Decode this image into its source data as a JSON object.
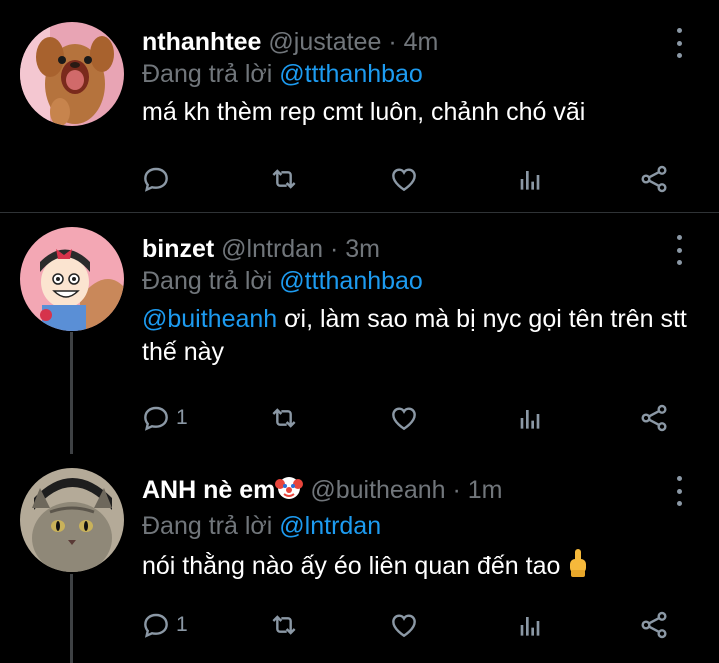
{
  "tweets": [
    {
      "display_name": "nthanhtee",
      "handle": "@justatee",
      "time": "· 4m",
      "replying_prefix": "Đang trả lời",
      "replying_to": "@ttthanhbao",
      "text": "má kh thèm rep cmt luôn, chảnh chó vãi",
      "reply_count": ""
    },
    {
      "display_name": "binzet",
      "handle": "@lntrdan",
      "time": "· 3m",
      "replying_prefix": "Đang trả lời",
      "replying_to": "@ttthanhbao",
      "text_mention": "@buitheanh",
      "text": " ơi, làm sao mà bị nyc gọi tên trên stt thế này",
      "reply_count": "1"
    },
    {
      "display_name": "ANH nè em",
      "display_name_emoji": "clown-face",
      "handle": "@buitheanh",
      "time": "· 1m",
      "replying_prefix": "Đang trả lời",
      "replying_to": "@lntrdan",
      "text": "nói thằng nào ấy éo liên quan đến tao",
      "text_emoji": "raised-middle-finger",
      "reply_count": "1"
    }
  ],
  "icons": [
    "reply-icon",
    "retweet-icon",
    "like-icon",
    "analytics-icon",
    "share-icon",
    "more-options-icon"
  ],
  "colors": {
    "background": "#000000",
    "accent": "#1d9bf0",
    "muted": "#71767b",
    "divider": "#2f3336"
  }
}
